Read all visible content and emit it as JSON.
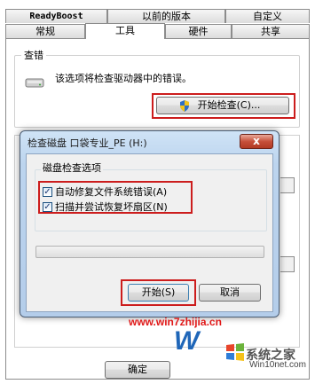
{
  "tabs_row1": [
    "ReadyBoost",
    "以前的版本",
    "自定义"
  ],
  "tabs_row2": [
    "常规",
    "工具",
    "硬件",
    "共享"
  ],
  "error_check": {
    "title": "查错",
    "description": "该选项将检查驱动器中的错误。",
    "button_label": "开始检查(C)..."
  },
  "dialog": {
    "title": "检查磁盘 口袋专业_PE (H:)",
    "close_glyph": "x",
    "options_title": "磁盘检查选项",
    "options": [
      {
        "label": "自动修复文件系统错误(A)",
        "checked": true
      },
      {
        "label": "扫描并尝试恢复坏扇区(N)",
        "checked": true
      }
    ],
    "progress": 0,
    "start_label": "开始(S)",
    "cancel_label": "取消"
  },
  "footer": {
    "ok_label": "确定"
  },
  "watermarks": {
    "url": "www.win7zhijia.cn",
    "logo_left": "W",
    "logo_right": "系统之家",
    "logo_right_sub": "Win10net.com"
  },
  "colors": {
    "highlight": "#cc1d1d",
    "dialog_frame": "#b4cdea",
    "close_button": "#c7503a"
  }
}
